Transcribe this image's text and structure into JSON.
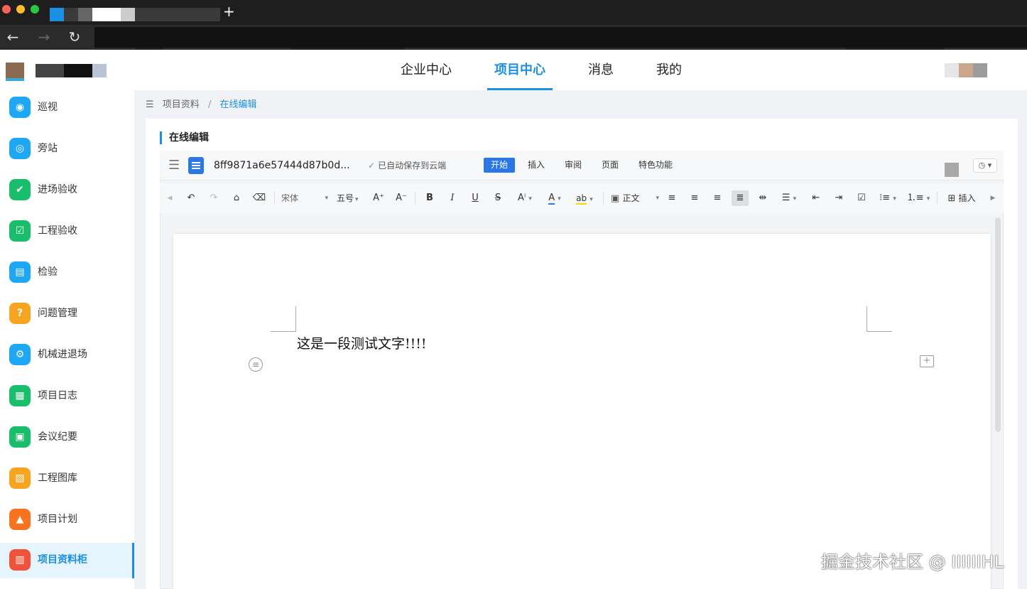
{
  "top_nav": {
    "items": [
      "企业中心",
      "项目中心",
      "消息",
      "我的"
    ],
    "active": "项目中心"
  },
  "sidebar": {
    "items": [
      {
        "label": "巡视",
        "icon": "eye-icon",
        "color": "#1ea7f5"
      },
      {
        "label": "旁站",
        "icon": "fingerprint-icon",
        "color": "#1ea7f5"
      },
      {
        "label": "进场验收",
        "icon": "check-circle-icon",
        "color": "#19be6b"
      },
      {
        "label": "工程验收",
        "icon": "check-square-icon",
        "color": "#19be6b"
      },
      {
        "label": "检验",
        "icon": "inspection-icon",
        "color": "#1ea7f5"
      },
      {
        "label": "问题管理",
        "icon": "question-badge-icon",
        "color": "#f7a520"
      },
      {
        "label": "机械进退场",
        "icon": "machine-icon",
        "color": "#1ea7f5"
      },
      {
        "label": "项目日志",
        "icon": "calendar-icon",
        "color": "#19be6b"
      },
      {
        "label": "会议纪要",
        "icon": "presentation-icon",
        "color": "#19be6b"
      },
      {
        "label": "工程图库",
        "icon": "image-icon",
        "color": "#f7a520"
      },
      {
        "label": "项目计划",
        "icon": "plan-icon",
        "color": "#f77320"
      },
      {
        "label": "项目资料柜",
        "icon": "cabinet-icon",
        "color": "#f0533a"
      }
    ],
    "active": "项目资料柜"
  },
  "breadcrumb": {
    "parent": "项目资料",
    "separator": "/",
    "current": "在线编辑"
  },
  "panel": {
    "title": "在线编辑"
  },
  "editor": {
    "doc_name": "8ff9871a6e57444d87b0d...",
    "save_status": "已自动保存到云端",
    "menu_tabs": [
      "开始",
      "插入",
      "审阅",
      "页面",
      "特色功能"
    ],
    "active_menu_tab": "开始",
    "toolbar": {
      "font_family": "宋体",
      "font_size": "五号",
      "paragraph_style": "正文",
      "insert_label": "插入"
    },
    "content": "这是一段测试文字!!!!"
  },
  "watermark": "掘金技术社区 @ IIIIIIHL",
  "colors": {
    "accent": "#1a8fe3",
    "editor_accent": "#2b77e5"
  }
}
